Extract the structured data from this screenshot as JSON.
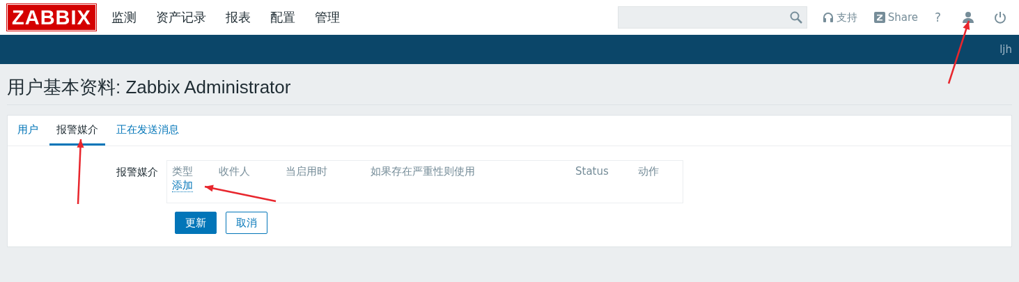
{
  "logo": "ZABBIX",
  "nav": [
    "监测",
    "资产记录",
    "报表",
    "配置",
    "管理"
  ],
  "header_links": [
    {
      "kind": "support",
      "label": "支持"
    },
    {
      "kind": "share",
      "label": "Share"
    },
    {
      "kind": "help",
      "label": "?"
    },
    {
      "kind": "user"
    },
    {
      "kind": "logout"
    }
  ],
  "user_name": "ljh",
  "title": "用户基本资料: Zabbix Administrator",
  "tabs": [
    {
      "label": "用户",
      "selected": false
    },
    {
      "label": "报警媒介",
      "selected": true
    },
    {
      "label": "正在发送消息",
      "selected": false
    }
  ],
  "media": {
    "label": "报警媒介",
    "columns": [
      "类型",
      "收件人",
      "当启用时",
      "如果存在严重性则使用",
      "Status",
      "动作"
    ],
    "add_link": "添加"
  },
  "buttons": [
    {
      "label": "更新",
      "kind": "primary"
    },
    {
      "label": "取消",
      "kind": "secondary"
    }
  ],
  "annotations": [
    {
      "kind": "arrow"
    },
    {
      "kind": "arrow"
    },
    {
      "kind": "arrow"
    }
  ]
}
